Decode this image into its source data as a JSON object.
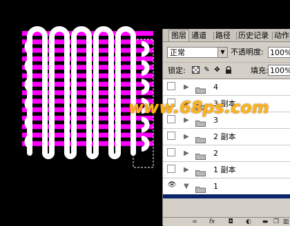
{
  "colors": {
    "background": "#000000",
    "stripe": "#ff00ff",
    "loop": "#ffffff",
    "watermark": "#ffb31a",
    "panel": "#d4d0c8",
    "selection": "#0a246a"
  },
  "panel": {
    "tabs": [
      "图层",
      "通道",
      "路径",
      "历史记录",
      "动作"
    ],
    "blend_mode": "正常",
    "opacity_label": "不透明度:",
    "opacity_value": "100%",
    "lock_label": "锁定:",
    "fill_label": "填充:",
    "fill_value": "100%",
    "lock_icons": [
      "lock-transparent-icon",
      "lock-pixels-icon",
      "lock-position-icon",
      "lock-all-icon"
    ],
    "layers": [
      {
        "name": "4",
        "visible": false,
        "expanded": false
      },
      {
        "name": "3 副本",
        "visible": false,
        "expanded": false
      },
      {
        "name": "3",
        "visible": false,
        "expanded": false
      },
      {
        "name": "2 副本",
        "visible": false,
        "expanded": false
      },
      {
        "name": "2",
        "visible": false,
        "expanded": false
      },
      {
        "name": "1 副本",
        "visible": false,
        "expanded": false
      },
      {
        "name": "1",
        "visible": true,
        "expanded": true
      }
    ],
    "bottom_icons": [
      "link-icon",
      "fx-icon",
      "mask-icon",
      "adjustment-icon",
      "folder-icon",
      "new-layer-icon",
      "trash-icon"
    ]
  },
  "watermark": "www.68ps.com"
}
